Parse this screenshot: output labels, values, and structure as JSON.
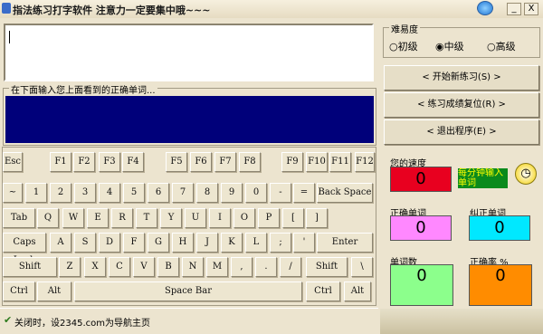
{
  "title": "指法练习打字软件  注意力一定要集中哦~~~",
  "window": {
    "minimize_label": "_",
    "close_label": "X"
  },
  "difficulty": {
    "label": "难易度",
    "options": [
      "初级",
      "中级",
      "高级"
    ],
    "selected": "中级"
  },
  "input_hint": "在下面输入您上面看到的正确单词...",
  "buttons": {
    "new": "< 开始新练习(S) >",
    "reset": "< 练习成绩复位(R) >",
    "exit": "< 退出程序(E) >"
  },
  "stats": {
    "speed_label": "您的速度",
    "speed_value": "0",
    "speed_note": "每分钟输入单词",
    "correct_label": "正确单词",
    "correct_value": "0",
    "fixed_label": "纠正单词",
    "fixed_value": "0",
    "count_label": "单词数",
    "count_value": "0",
    "rate_label": "正确率 %",
    "rate_value": "0"
  },
  "status": "关闭时，设2345.com为导航主页",
  "colors": {
    "input_bg": "#00007a",
    "speed": "#e8001f",
    "correct": "#ff88ff",
    "fixed": "#00e8ff",
    "count": "#8cff8c",
    "rate": "#ff8c00"
  },
  "keys": {
    "row0": [
      "Esc",
      "F1",
      "F2",
      "F3",
      "F4",
      "F5",
      "F6",
      "F7",
      "F8",
      "F9",
      "F10",
      "F11",
      "F12"
    ],
    "row1": [
      "~",
      "1",
      "2",
      "3",
      "4",
      "5",
      "6",
      "7",
      "8",
      "9",
      "0",
      "-",
      "=",
      "Back Space"
    ],
    "row2": [
      "Tab",
      "Q",
      "W",
      "E",
      "R",
      "T",
      "Y",
      "U",
      "I",
      "O",
      "P",
      "[",
      "]"
    ],
    "row3": [
      "Caps Lock",
      "A",
      "S",
      "D",
      "F",
      "G",
      "H",
      "J",
      "K",
      "L",
      ";",
      "'",
      "Enter"
    ],
    "row4": [
      "Shift",
      "Z",
      "X",
      "C",
      "V",
      "B",
      "N",
      "M",
      ",",
      ".",
      "/",
      "Shift",
      "\\"
    ],
    "row5": [
      "Ctrl",
      "Alt",
      "Space Bar",
      "Ctrl",
      "Alt"
    ]
  }
}
